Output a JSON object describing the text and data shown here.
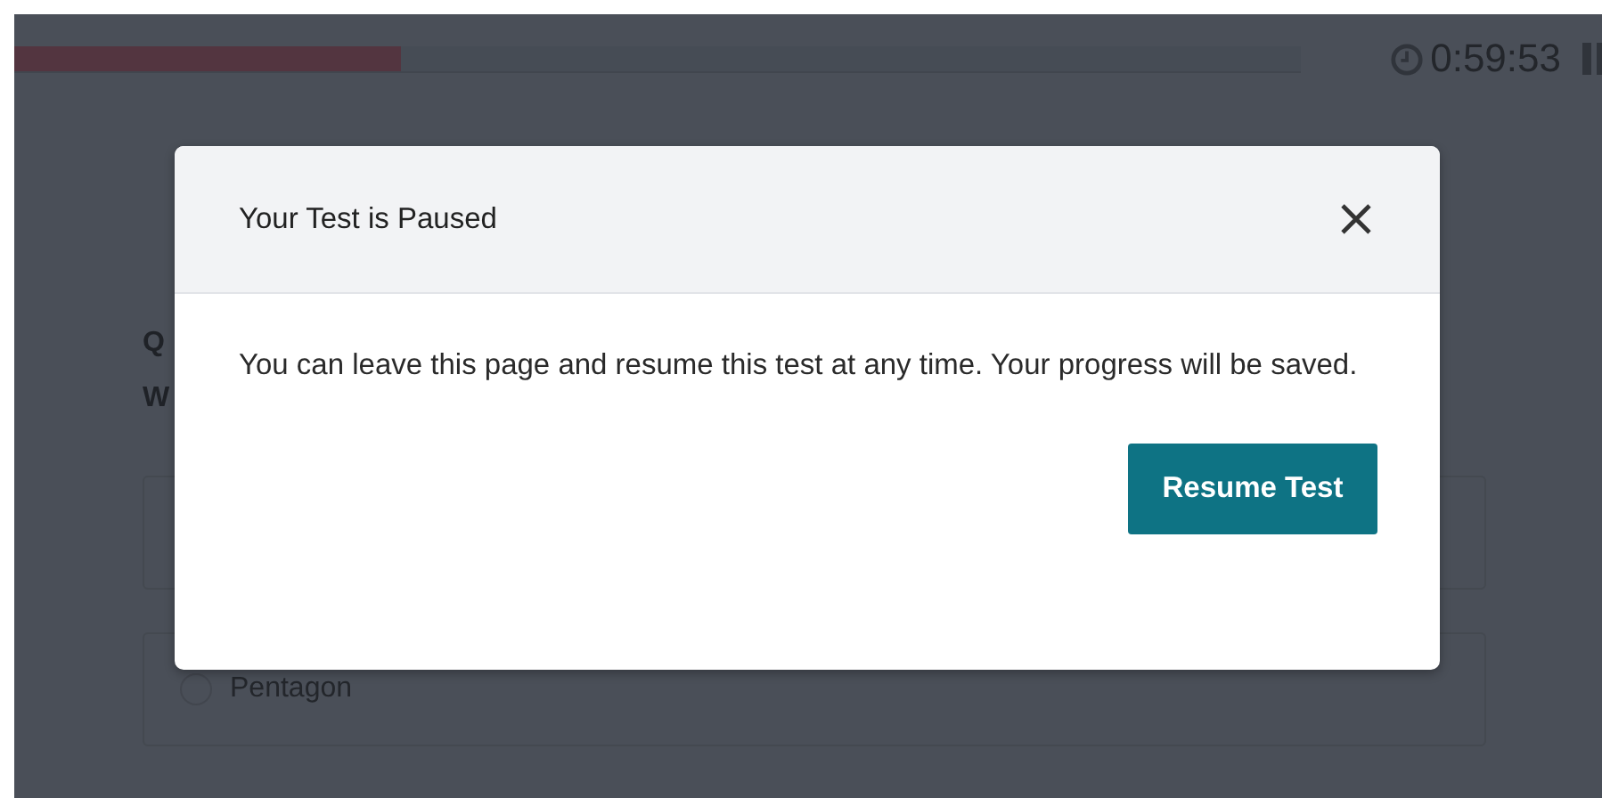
{
  "progress": {
    "level": 0.3
  },
  "timer": {
    "time": "0:59:53"
  },
  "question": {
    "number_fragment": "Q",
    "text_fragment": "W"
  },
  "answer_options": [
    {
      "label": "Pentagon",
      "selected": false
    }
  ],
  "dialog": {
    "title": "Your Test is Paused",
    "message": "You can leave this page and resume this test at any time. Your progress will be saved.",
    "button": "Resume Test"
  }
}
